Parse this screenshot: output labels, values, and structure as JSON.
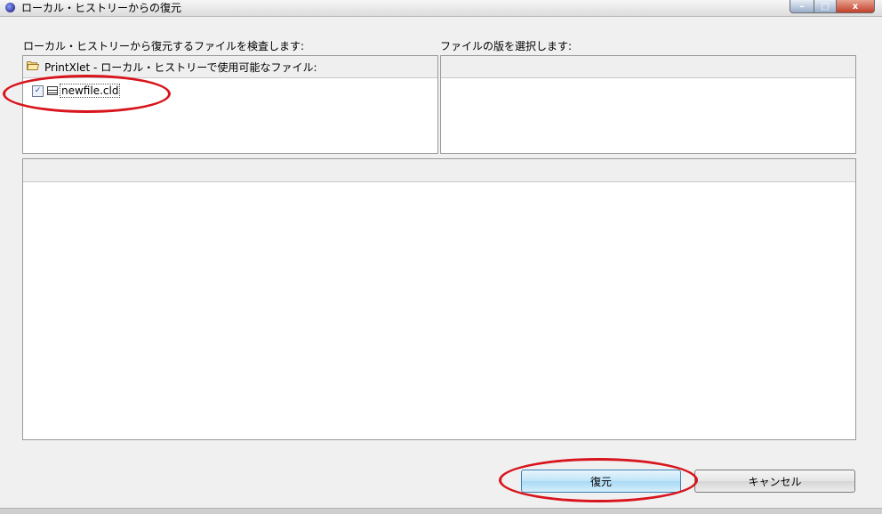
{
  "window": {
    "title": "ローカル・ヒストリーからの復元",
    "minimize_label": "–",
    "maximize_label": "□",
    "close_label": "x"
  },
  "left_panel": {
    "label": "ローカル・ヒストリーから復元するファイルを検査します:",
    "header": "PrintXlet - ローカル・ヒストリーで使用可能なファイル:",
    "files": [
      {
        "name": "newfile.cld",
        "checked": true
      }
    ]
  },
  "right_panel": {
    "label": "ファイルの版を選択します:",
    "header": ""
  },
  "preview_panel": {
    "header": ""
  },
  "buttons": {
    "restore": "復元",
    "cancel": "キャンセル"
  },
  "colors": {
    "annotation": "#d8141c",
    "primary_button": "#bfe4f8"
  }
}
